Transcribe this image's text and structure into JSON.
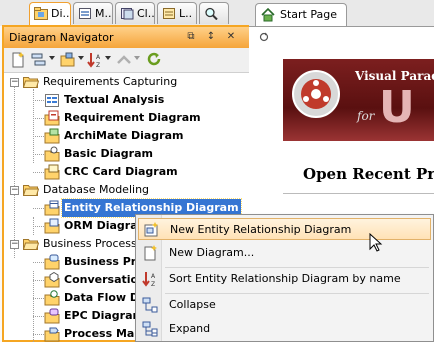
{
  "left_tabs": [
    {
      "label": "Di..",
      "icon": "diagram-navigator-icon",
      "active": true
    },
    {
      "label": "M..",
      "icon": "model-explorer-icon"
    },
    {
      "label": "Cl..",
      "icon": "class-repository-icon"
    },
    {
      "label": "L..",
      "icon": "layers-icon"
    },
    {
      "label": "",
      "icon": "search-icon"
    }
  ],
  "navigator": {
    "title": "Diagram Navigator",
    "header_buttons": [
      "restore-icon",
      "pin-icon",
      "close-icon"
    ],
    "toolbar": [
      "new-diagram-icon",
      "view-options-icon",
      "open-folder-icon",
      "sort-icon",
      "up-icon",
      "refresh-icon"
    ]
  },
  "tree": {
    "groups": [
      {
        "label": "Requirements Capturing",
        "expanded": true,
        "items": [
          "Textual Analysis",
          "Requirement Diagram",
          "ArchiMate Diagram",
          "Basic Diagram",
          "CRC Card Diagram"
        ]
      },
      {
        "label": "Database Modeling",
        "expanded": true,
        "items": [
          "Entity Relationship Diagram",
          "ORM Diagram"
        ]
      },
      {
        "label": "Business Process M",
        "expanded": true,
        "items": [
          "Business Proc",
          "Conversation",
          "Data Flow Dia",
          "EPC Diagram",
          "Process Map"
        ]
      }
    ],
    "selected": "Entity Relationship Diagram"
  },
  "right": {
    "tab_label": "Start Page",
    "banner_brand": "Visual Parad",
    "banner_sub": "for",
    "banner_big": "U",
    "recent_heading": "Open Recent Pro"
  },
  "context_menu": {
    "items": [
      {
        "label": "New Entity Relationship Diagram",
        "icon": "new-erd-icon",
        "highlighted": true
      },
      {
        "label": "New Diagram...",
        "icon": "new-diagram-icon"
      },
      {
        "separator": true
      },
      {
        "label": "Sort Entity Relationship Diagram by name",
        "icon": "sort-icon"
      },
      {
        "separator": true
      },
      {
        "label": "Collapse",
        "icon": "collapse-icon"
      },
      {
        "label": "Expand",
        "icon": "expand-icon"
      }
    ]
  },
  "colors": {
    "accent_orange": "#f5a623",
    "selection_blue": "#3575d3",
    "banner_red": "#7c1f1f"
  }
}
